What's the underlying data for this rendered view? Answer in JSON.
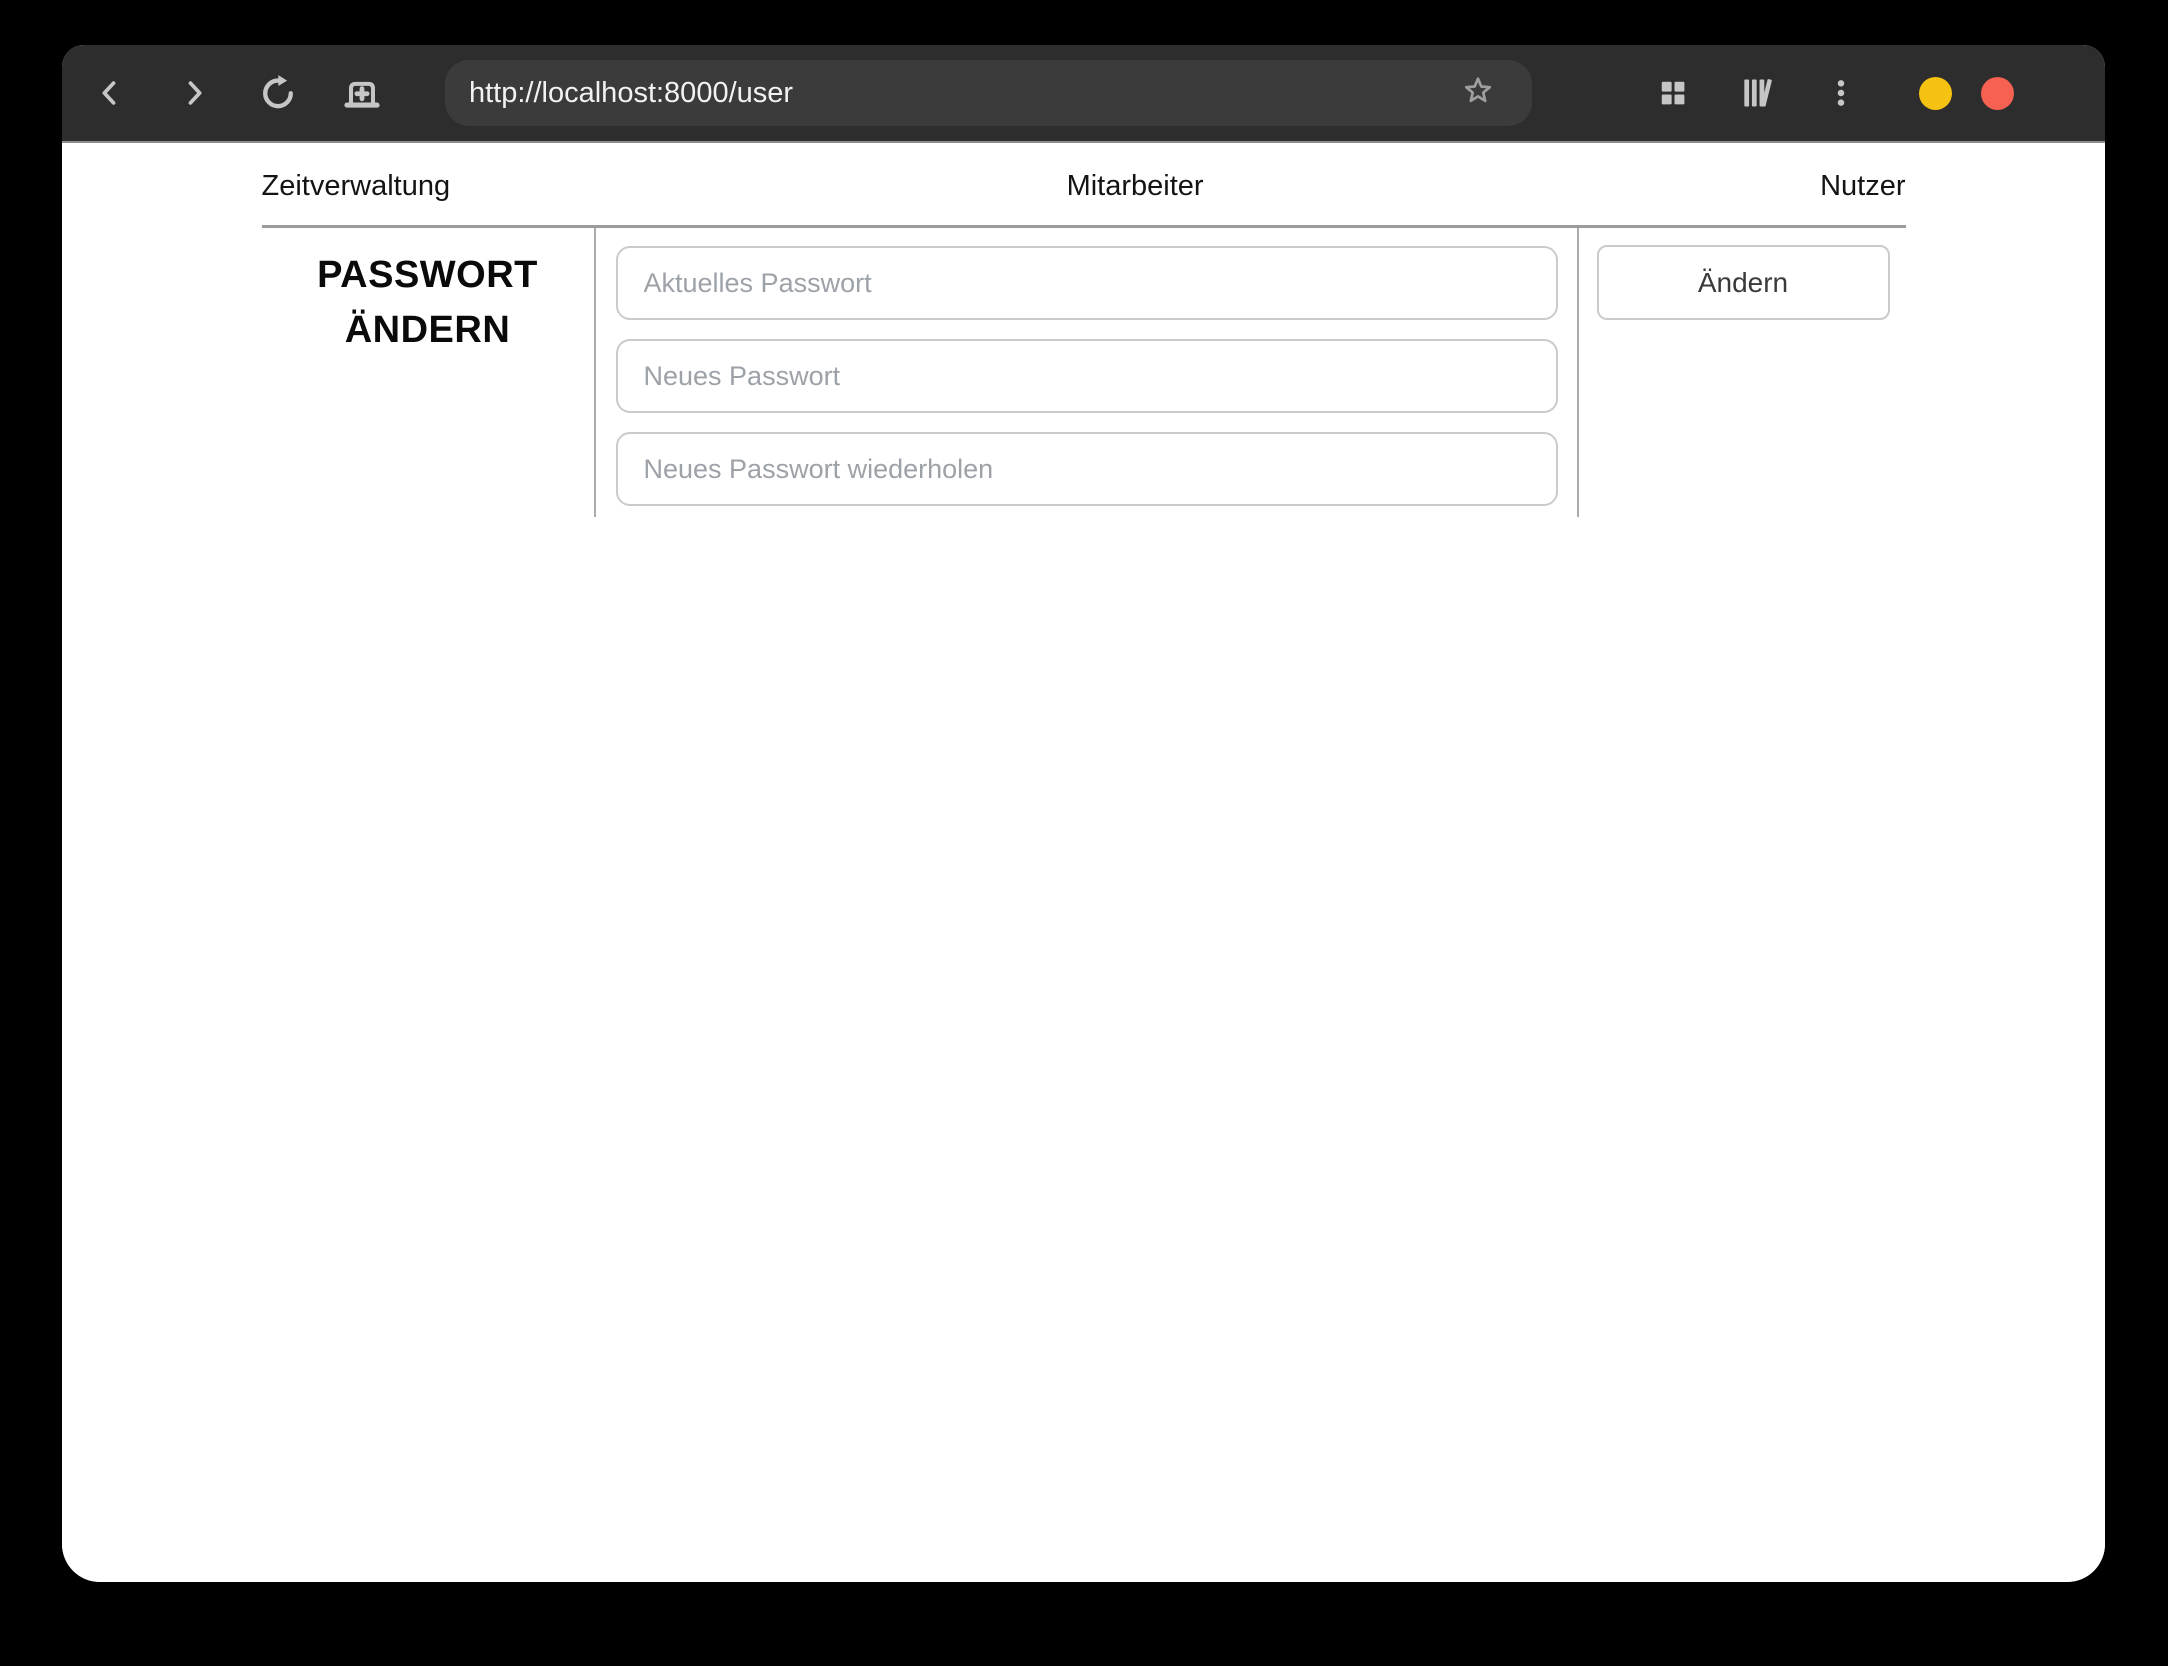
{
  "window": {
    "controls": [
      {
        "name": "minimize",
        "color": "#f5c211"
      },
      {
        "name": "close",
        "color": "#f66151"
      }
    ]
  },
  "browser": {
    "url": "http://localhost:8000/user",
    "toolbar_icons": [
      "back",
      "forward",
      "reload",
      "new-tab",
      "bookmark-star",
      "grid",
      "library",
      "kebab-menu"
    ]
  },
  "nav": {
    "items": [
      {
        "label": "Zeitverwaltung"
      },
      {
        "label": "Mitarbeiter"
      },
      {
        "label": "Nutzer"
      }
    ]
  },
  "main": {
    "heading": "PASSWORT ÄNDERN",
    "form": {
      "fields": [
        {
          "placeholder": "Aktuelles Passwort"
        },
        {
          "placeholder": "Neues Passwort"
        },
        {
          "placeholder": "Neues Passwort wiederholen"
        }
      ],
      "submit_label": "Ändern"
    }
  },
  "colors": {
    "toolbar_bg": "#2d2d2d",
    "urlbar_bg": "#3b3b3b",
    "icon_gray": "#c6c6c6",
    "minimize_yellow": "#f5c211",
    "close_red": "#f66151",
    "nav_border": "#9b9b9b",
    "divider_gray": "#ababab",
    "input_border": "#cbcbcb",
    "placeholder_gray": "#9da2a8"
  }
}
